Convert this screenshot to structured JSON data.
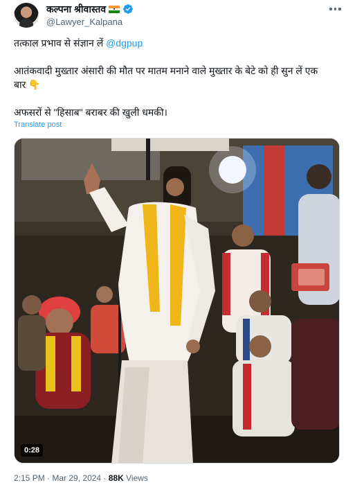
{
  "author": {
    "display_name": "कल्पना श्रीवास्तव",
    "handle": "@Lawyer_Kalpana",
    "verified": true,
    "flag_icon": "india-flag-icon",
    "verified_color": "#1d9bf0"
  },
  "tweet": {
    "line1_text": "तत्काल प्रभाव से संज्ञान लें ",
    "line1_mention": "@dgpup",
    "line2": "आतंकवादी मुख्तार अंसारी की मौत पर मातम मनाने वाले मुख्तार के बेटे को ही सुन लें एक",
    "line3": "बार 👇",
    "line4": "अफसरों से \"हिसाब\" बराबर की खुली धमकी।",
    "translate_label": "Translate post"
  },
  "media": {
    "type": "video",
    "timecode": "0:28"
  },
  "meta": {
    "time": "2:15 PM",
    "separator": " · ",
    "date": "Mar 29, 2024",
    "views_count": "88K",
    "views_label": " Views"
  },
  "colors": {
    "text": "#0f1419",
    "secondary": "#536471",
    "link": "#1d9bf0"
  }
}
